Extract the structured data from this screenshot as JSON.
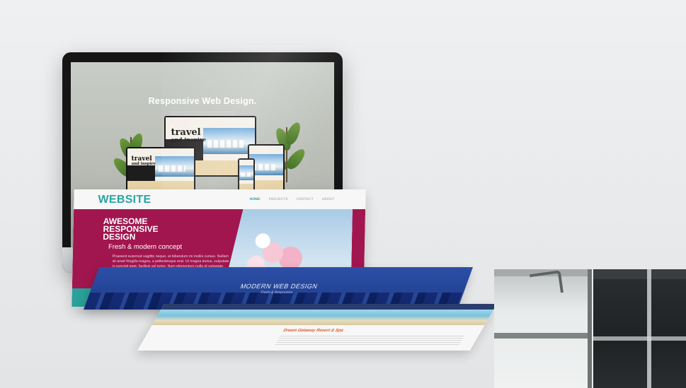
{
  "monitor": {
    "headline": "Responsive Web Design.",
    "device_text_line1": "travel",
    "device_text_line2": "and inspire"
  },
  "pages": {
    "pink_page": {
      "logo": "WEBSITE",
      "nav": [
        "HOME",
        "PROJECTS",
        "CONTACT",
        "ABOUT"
      ],
      "headline_lines": [
        "AWESOME",
        "RESPONSIVE",
        "DESIGN"
      ],
      "tagline": "Fresh & modern concept",
      "body": "Praesent euismod sagittis neque, at bibendum mi mollis cursus. Nullam sit amet fringilla magna, a pellentesque erat. Ut magna lectus, vulputate in suscipit eget, facilisis vel tortor. Nam elementum nulla id vulputate fermentum. Vestibulum tellus quam,"
    },
    "blue_page": {
      "title": "MODERN WEB DESIGN",
      "subtitle": "Fresh & Responsive"
    },
    "beach_page": {
      "title": "Dream Getaway Resort & Spa"
    }
  },
  "colors": {
    "background": "#e9eaec",
    "pink": "#a2164f",
    "teal": "#2aa19a",
    "blue": "#2c4fa6",
    "accent_green": "#7fc241"
  }
}
